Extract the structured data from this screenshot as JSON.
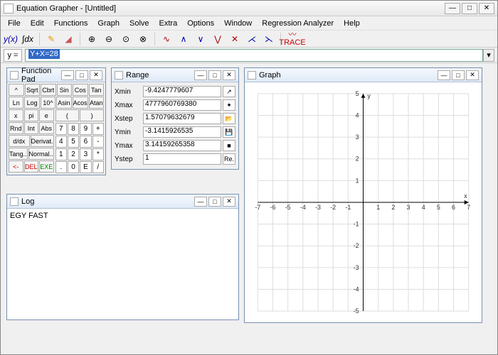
{
  "title": "Equation Grapher - [Untitled]",
  "menu": [
    "File",
    "Edit",
    "Functions",
    "Graph",
    "Solve",
    "Extra",
    "Options",
    "Window",
    "Regression Analyzer",
    "Help"
  ],
  "input_label": "y =",
  "input_value": "Y+X=28",
  "trace_label": "TRACE",
  "function_pad": {
    "title": "Function Pad",
    "rows": [
      [
        "^",
        "Sqrt",
        "Cbrt",
        "Sin",
        "Cos",
        "Tan"
      ],
      [
        "Ln",
        "Log",
        "10^",
        "Asin",
        "Acos",
        "Atan"
      ]
    ],
    "row3": [
      "x",
      "pi",
      "e"
    ],
    "row4": [
      "Rnd",
      "Int",
      "Abs"
    ],
    "brackets": [
      "(",
      ")"
    ],
    "row5": [
      "d/dx",
      "Derivat."
    ],
    "row6": [
      "Tang..",
      "Normal.."
    ],
    "bottom": [
      "<-",
      "DEL",
      "EXE"
    ],
    "keypad": [
      "7",
      "8",
      "9",
      "+",
      "4",
      "5",
      "6",
      "-",
      "1",
      "2",
      "3",
      "*",
      ".",
      "0",
      "E",
      "/"
    ]
  },
  "range": {
    "title": "Range",
    "rows": [
      {
        "label": "Xmin",
        "value": "-9.4247779607"
      },
      {
        "label": "Xmax",
        "value": "4777960769380"
      },
      {
        "label": "Xstep",
        "value": "1.57079632679"
      },
      {
        "label": "Ymin",
        "value": "-3.1415926535"
      },
      {
        "label": "Ymax",
        "value": "3.14159265358"
      },
      {
        "label": "Ystep",
        "value": "1"
      }
    ],
    "re_label": "Re."
  },
  "log": {
    "title": "Log",
    "content": "EGY FAST"
  },
  "graph": {
    "title": "Graph",
    "x_label": "x",
    "y_label": "y"
  },
  "chart_data": {
    "type": "line",
    "title": "",
    "xlabel": "x",
    "ylabel": "y",
    "xlim": [
      -7,
      7
    ],
    "ylim": [
      -5,
      5
    ],
    "x_ticks": [
      -7,
      -6,
      -5,
      -4,
      -3,
      -2,
      -1,
      1,
      2,
      3,
      4,
      5,
      6,
      7
    ],
    "y_ticks": [
      -5,
      -4,
      -3,
      -2,
      -1,
      1,
      2,
      3,
      4,
      5
    ],
    "series": []
  }
}
